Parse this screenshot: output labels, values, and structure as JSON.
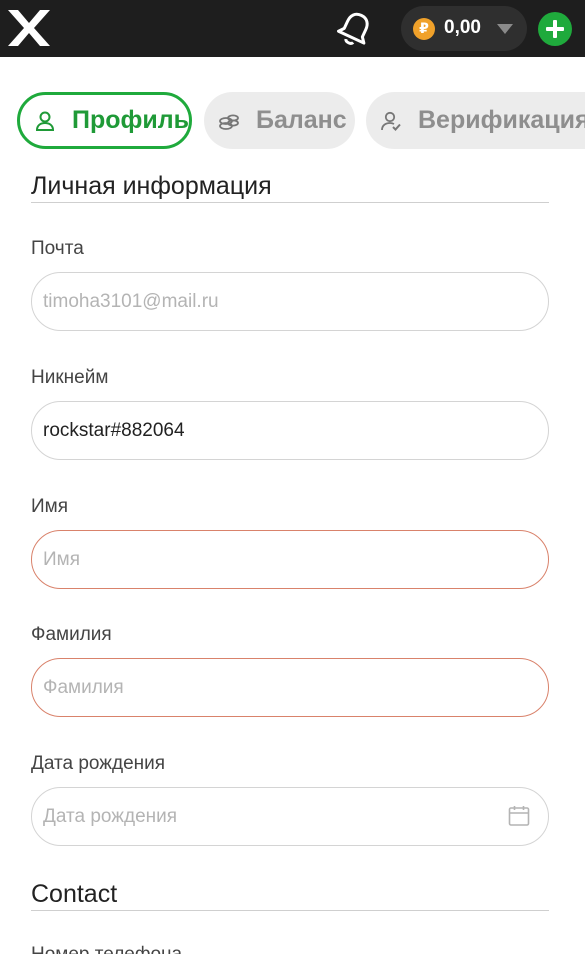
{
  "header": {
    "balance": "0,00",
    "currency_symbol": "₽",
    "colors": {
      "bar": "#1e1e1e",
      "accent": "#1faa3c",
      "coin": "#f0a12a"
    }
  },
  "tabs": [
    {
      "label": "Профиль",
      "icon": "user-icon",
      "active": true
    },
    {
      "label": "Баланс",
      "icon": "coins-icon",
      "active": false
    },
    {
      "label": "Верификация",
      "icon": "user-check-icon",
      "active": false
    }
  ],
  "personal": {
    "title": "Личная информация",
    "email": {
      "label": "Почта",
      "value": "timoha3101@mail.ru"
    },
    "nickname": {
      "label": "Никнейм",
      "value": "rockstar#882064"
    },
    "first_name": {
      "label": "Имя",
      "placeholder": "Имя"
    },
    "last_name": {
      "label": "Фамилия",
      "placeholder": "Фамилия"
    },
    "birth_date": {
      "label": "Дата рождения",
      "placeholder": "Дата рождения"
    }
  },
  "contact": {
    "title": "Contact",
    "phone_label": "Номер телефона"
  }
}
